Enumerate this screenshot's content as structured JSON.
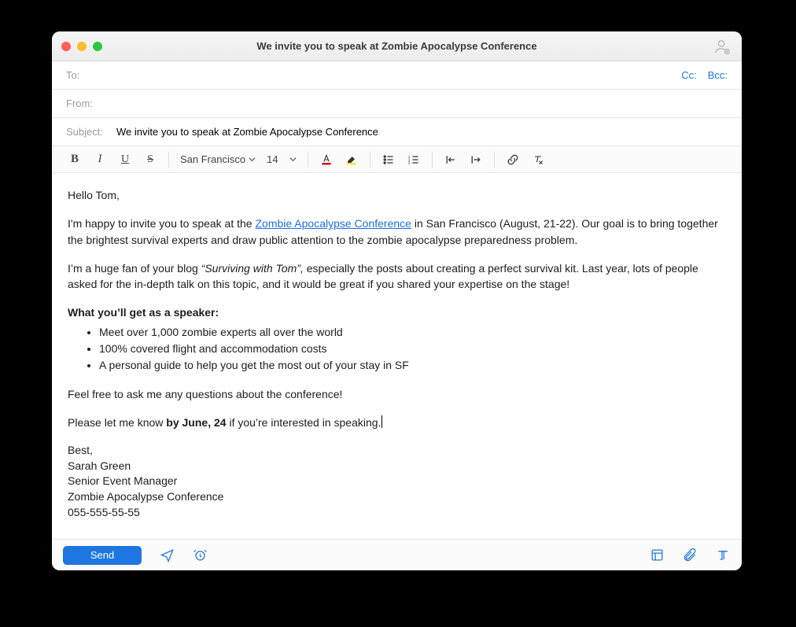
{
  "window": {
    "title": "We invite you to speak at Zombie Apocalypse Conference"
  },
  "header": {
    "to_label": "To:",
    "to_value": "",
    "cc_label": "Cc:",
    "bcc_label": "Bcc:",
    "from_label": "From:",
    "from_value": "",
    "subject_label": "Subject:",
    "subject_value": "We invite you to speak at Zombie Apocalypse Conference"
  },
  "toolbar": {
    "font_family": "San Francisco",
    "font_size": "14"
  },
  "body": {
    "greeting": "Hello Tom,",
    "p1a": "I'm happy to invite you to speak at the ",
    "p1_link": "Zombie Apocalypse Conference",
    "p1b": " in San Francisco (August, 21-22). Our goal is to bring together the brightest survival experts and draw public attention to the zombie apocalypse preparedness problem.",
    "p2a": "I’m a huge fan of your blog ",
    "p2_italic": "“Surviving with Tom”,",
    "p2b": " especially the posts about creating a perfect survival kit. Last year, lots of people asked for the in-depth talk on this topic, and it would be great if you shared your expertise on the stage!",
    "benefits_title": "What you’ll get as a speaker:",
    "benefits": [
      "Meet over 1,000 zombie experts all over the world",
      "100% covered flight and accommodation costs",
      "A personal guide to help you get the most out of your stay in SF"
    ],
    "p3": "Feel free to ask me any questions about the conference!",
    "p4a": "Please let me know ",
    "p4_bold": "by June, 24",
    "p4b": " if you’re interested in speaking.",
    "sig_off": "Best,",
    "sig_name": "Sarah Green",
    "sig_role": "Senior Event Manager",
    "sig_org": "Zombie Apocalypse Conference",
    "sig_phone": "055-555-55-55"
  },
  "footer": {
    "send_label": "Send"
  }
}
